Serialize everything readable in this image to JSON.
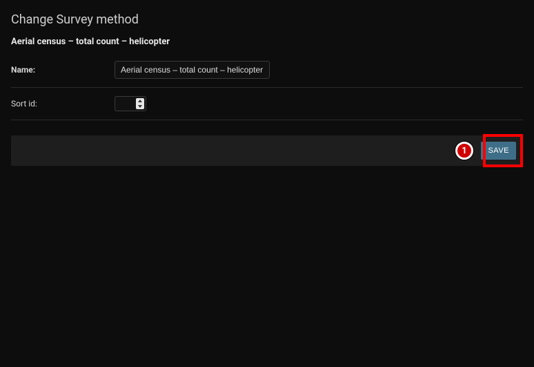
{
  "page_title": "Change Survey method",
  "object_name": "Aerial census – total count – helicopter",
  "fields": {
    "name": {
      "label": "Name:",
      "value": "Aerial census – total count – helicopter"
    },
    "sort_id": {
      "label": "Sort id:",
      "value": ""
    }
  },
  "actions": {
    "save_label": "SAVE"
  },
  "callout": {
    "number": "1"
  }
}
